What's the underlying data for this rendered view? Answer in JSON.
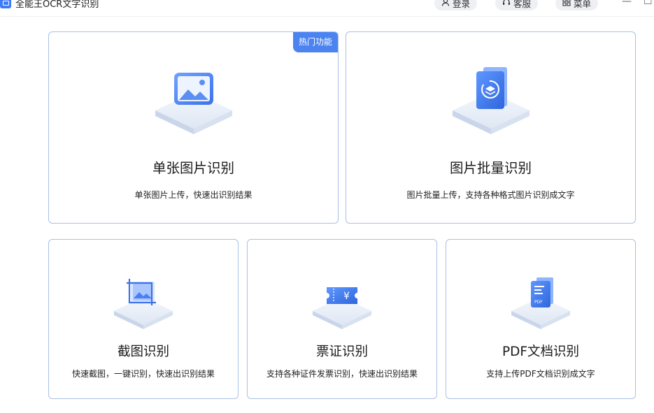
{
  "app": {
    "title": "全能王OCR文字识别"
  },
  "header": {
    "login_label": "登录",
    "service_label": "客服",
    "menu_label": "菜单",
    "login_icon": "user-icon",
    "service_icon": "headset-icon",
    "menu_icon": "grid-icon"
  },
  "cards": {
    "single": {
      "title": "单张图片识别",
      "desc": "单张图片上传，快速出识别结果",
      "badge": "热门功能",
      "icon": "image-icon"
    },
    "batch": {
      "title": "图片批量识别",
      "desc": "图片批量上传，支持各种格式图片识别成文字",
      "icon": "batch-layers-icon"
    },
    "screenshot": {
      "title": "截图识别",
      "desc": "快速截图，一键识别，快速出识别结果",
      "icon": "crop-image-icon"
    },
    "ticket": {
      "title": "票证识别",
      "desc": "支持各种证件发票识别，快速出识别结果",
      "icon": "ticket-yen-icon"
    },
    "pdf": {
      "title": "PDF文档识别",
      "desc": "支持上传PDF文档识别成文字",
      "icon": "pdf-document-icon"
    }
  },
  "colors": {
    "accent": "#4b84f1",
    "card_border": "#a9c1e6",
    "badge_bg": "#4b84f1"
  }
}
